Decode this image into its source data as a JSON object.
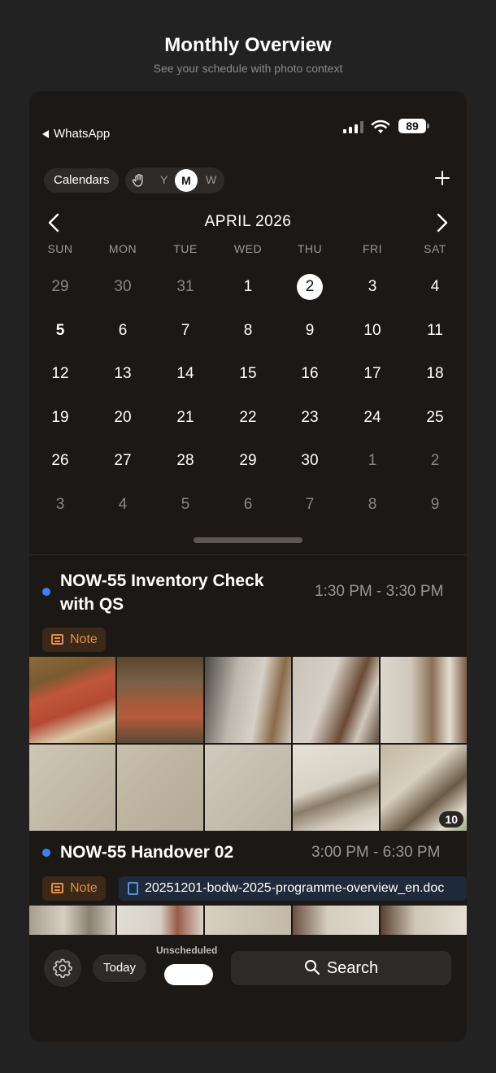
{
  "header": {
    "title": "Monthly Overview",
    "subtitle": "See your schedule with photo context"
  },
  "status_bar": {
    "back_label": "WhatsApp",
    "battery": "89"
  },
  "toolbar": {
    "calendars_label": "Calendars",
    "view_modes": [
      "Y",
      "M",
      "W"
    ],
    "selected_view": "M"
  },
  "calendar": {
    "month_title": "APRIL 2026",
    "weekdays": [
      "SUN",
      "MON",
      "TUE",
      "WED",
      "THU",
      "FRI",
      "SAT"
    ],
    "weeks": [
      [
        "29",
        "30",
        "31",
        "1",
        "2",
        "3",
        "4"
      ],
      [
        "5",
        "6",
        "7",
        "8",
        "9",
        "10",
        "11"
      ],
      [
        "12",
        "13",
        "14",
        "15",
        "16",
        "17",
        "18"
      ],
      [
        "19",
        "20",
        "21",
        "22",
        "23",
        "24",
        "25"
      ],
      [
        "26",
        "27",
        "28",
        "29",
        "30",
        "1",
        "2"
      ],
      [
        "3",
        "4",
        "5",
        "6",
        "7",
        "8",
        "9"
      ]
    ],
    "today": "2",
    "selected": "5"
  },
  "events": [
    {
      "title_line1": "NOW-55 Inventory Check",
      "title_line2": "with QS",
      "time": "1:30 PM - 3:30 PM",
      "note_label": "Note",
      "extra_photo_count": "10"
    },
    {
      "title": "NOW-55 Handover 02",
      "time": "3:00 PM - 6:30 PM",
      "note_label": "Note",
      "attachment": "20251201-bodw-2025-programme-overview_en.doc"
    }
  ],
  "bottom_bar": {
    "today_label": "Today",
    "unscheduled_label": "Unscheduled",
    "search_label": "Search"
  },
  "colors": {
    "accent_blue": "#3c82f6",
    "note_orange": "#e0904a",
    "background": "#1c1816"
  }
}
